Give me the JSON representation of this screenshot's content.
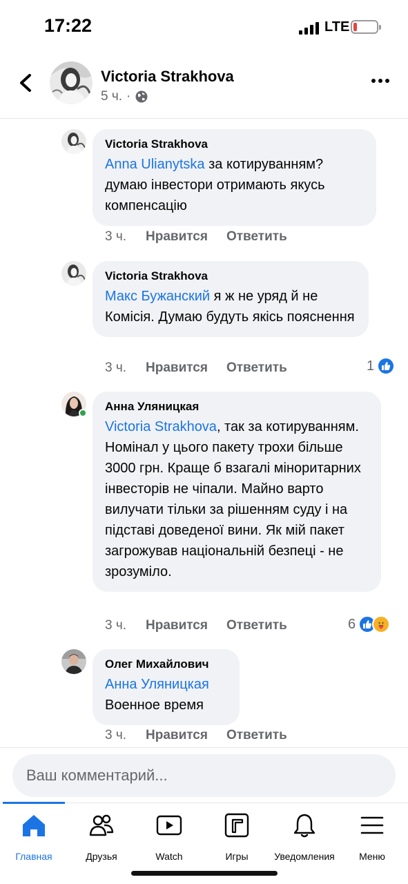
{
  "status": {
    "time": "17:22",
    "network": "LTE"
  },
  "header": {
    "name": "Victoria Strakhova",
    "time": "5 ч.",
    "separator": "·"
  },
  "comments": [
    {
      "author": "Victoria Strakhova",
      "mention": "Anna  Ulianytska",
      "text": " за котируванням? думаю інвестори отримають якусь компенсацію",
      "time": "3 ч.",
      "like": "Нравится",
      "reply": "Ответить",
      "reactions": ""
    },
    {
      "author": "Victoria Strakhova",
      "mention": "Макс Бужанский",
      "text": " я ж не уряд й не Комісія. Думаю будуть якісь пояснення",
      "time": "3 ч.",
      "like": "Нравится",
      "reply": "Ответить",
      "reactions": "1"
    },
    {
      "author": "Анна Уляницкая",
      "mention": "Victoria Strakhova",
      "text": ", так за котируванням. Номінал у цього пакету трохи більше 3000 грн. Краще б взагалі міноритарних інвесторів не чіпали. Майно варто вилучати тільки за рішенням суду і на підставі доведеної вини. Як мій пакет загрожував національній безпеці - не зрозуміло.",
      "time": "3 ч.",
      "like": "Нравится",
      "reply": "Ответить",
      "reactions": "6"
    },
    {
      "author": "Олег Михайлович",
      "mention": "Анна Уляницкая",
      "text": "Военное время",
      "time": "3 ч.",
      "like": "Нравится",
      "reply": "Ответить",
      "reactions": ""
    }
  ],
  "composer": {
    "placeholder": "Ваш комментарий..."
  },
  "tabs": [
    {
      "label": "Главная",
      "icon": "home-icon"
    },
    {
      "label": "Друзья",
      "icon": "friends-icon"
    },
    {
      "label": "Watch",
      "icon": "watch-icon"
    },
    {
      "label": "Игры",
      "icon": "gaming-icon"
    },
    {
      "label": "Уведомления",
      "icon": "bell-icon"
    },
    {
      "label": "Меню",
      "icon": "menu-icon"
    }
  ],
  "colors": {
    "accent": "#1b74e4",
    "bubble": "#f0f2f5",
    "meta": "#65676b",
    "online": "#31a24c"
  }
}
